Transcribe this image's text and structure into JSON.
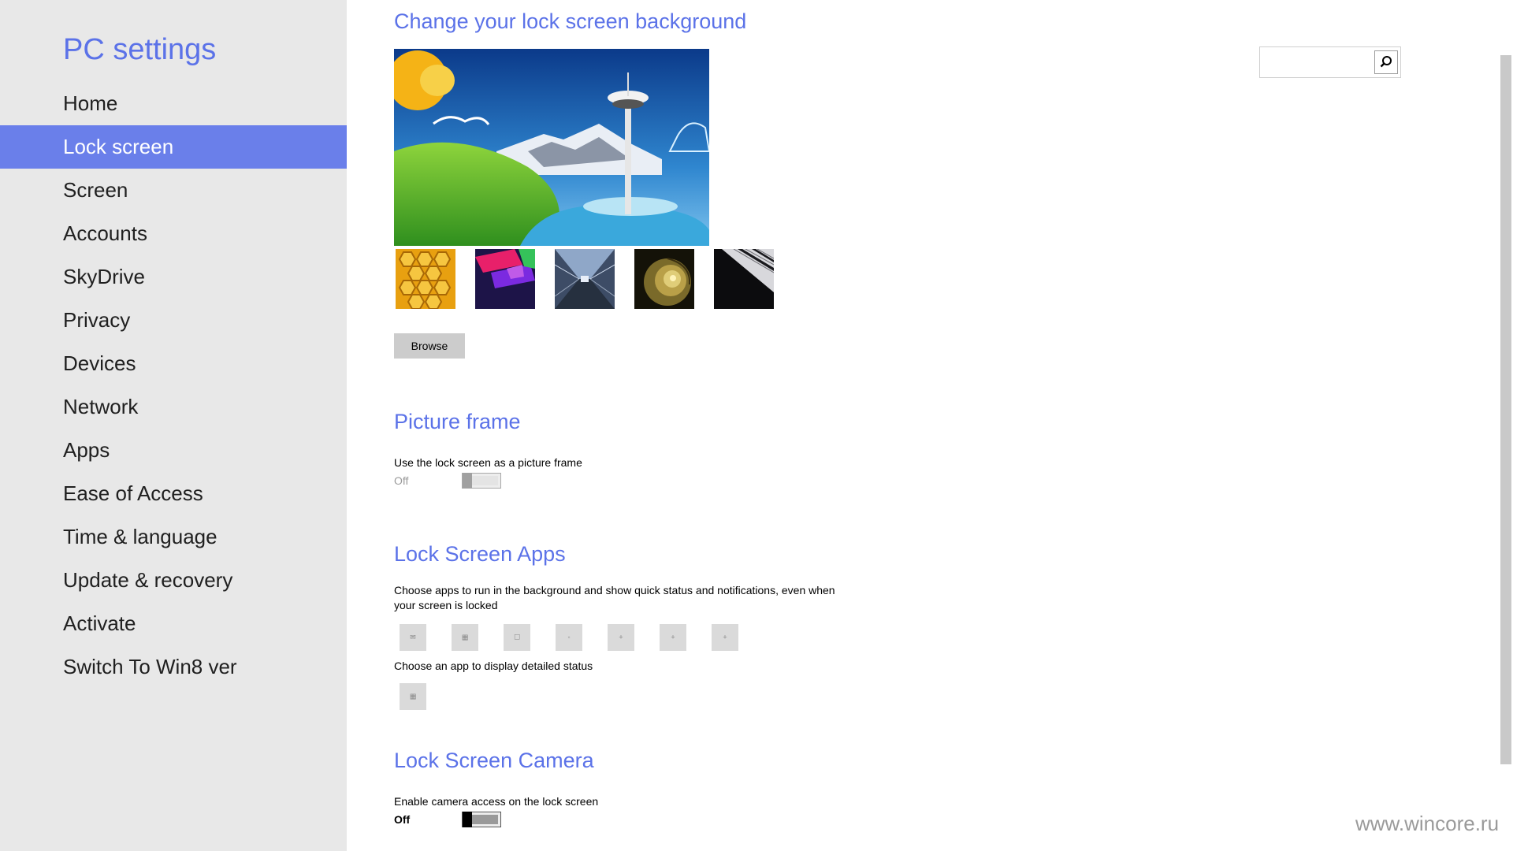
{
  "sidebar": {
    "title": "PC settings",
    "items": [
      {
        "label": "Home"
      },
      {
        "label": "Lock screen",
        "selected": true
      },
      {
        "label": "Screen"
      },
      {
        "label": "Accounts"
      },
      {
        "label": "SkyDrive"
      },
      {
        "label": "Privacy"
      },
      {
        "label": "Devices"
      },
      {
        "label": "Network"
      },
      {
        "label": "Apps"
      },
      {
        "label": "Ease of Access"
      },
      {
        "label": "Time & language"
      },
      {
        "label": "Update & recovery"
      },
      {
        "label": "Activate"
      },
      {
        "label": "Switch To Win8 ver"
      }
    ]
  },
  "background": {
    "title": "Change your lock screen background",
    "browse_label": "Browse",
    "thumbnails": [
      "honeycomb",
      "colored-ribbons",
      "escalator-tunnel",
      "nautilus-shell",
      "piano-keys"
    ]
  },
  "picture_frame": {
    "title": "Picture frame",
    "description": "Use the lock screen as a picture frame",
    "state": "Off"
  },
  "lock_apps": {
    "title": "Lock Screen Apps",
    "description": "Choose apps to run in the background and show quick status and notifications, even when your screen is locked",
    "detailed_label": "Choose an app to display detailed status"
  },
  "camera": {
    "title": "Lock Screen Camera",
    "description": "Enable camera access on the lock screen",
    "state": "Off"
  },
  "search": {
    "value": "",
    "icon": "search-icon"
  },
  "watermark": "www.wincore.ru",
  "colors": {
    "accent": "#5b72e8",
    "selected_bg": "#6a7fea",
    "sidebar_bg": "#e8e8e8"
  }
}
